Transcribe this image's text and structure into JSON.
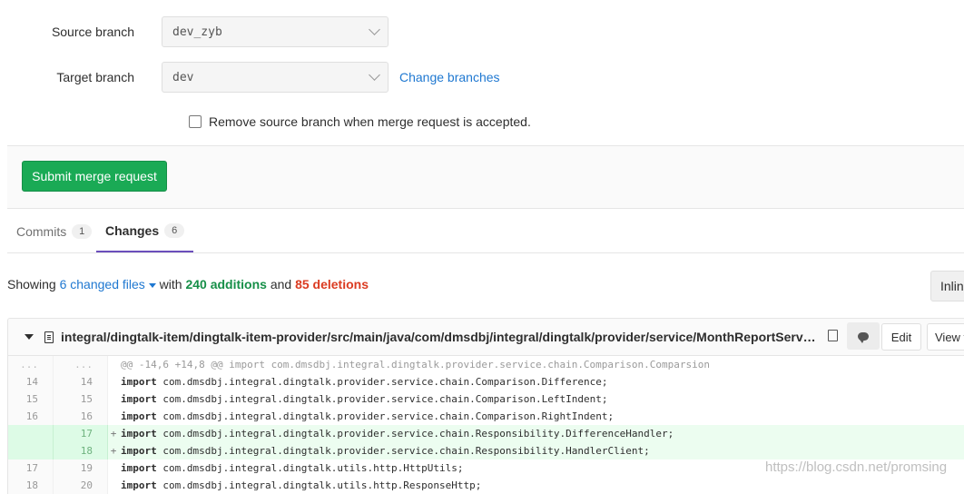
{
  "form": {
    "source_label": "Source branch",
    "source_value": "dev_zyb",
    "target_label": "Target branch",
    "target_value": "dev",
    "change_branches": "Change branches",
    "remove_branch_label": "Remove source branch when merge request is accepted.",
    "remove_branch_checked": false
  },
  "submit_label": "Submit merge request",
  "tabs": [
    {
      "label": "Commits",
      "count": "1",
      "active": false
    },
    {
      "label": "Changes",
      "count": "6",
      "active": true
    }
  ],
  "summary": {
    "showing": "Showing",
    "changed_files": "6 changed files",
    "with": "with",
    "additions": "240 additions",
    "and": "and",
    "deletions": "85 deletions"
  },
  "view_toggle": {
    "inline": "Inlin"
  },
  "file": {
    "path": "integral/dingtalk-item/dingtalk-item-provider/src/main/java/com/dmsdbj/integral/dingtalk/provider/service/MonthReportServiceImpl.java",
    "edit_label": "Edit",
    "view_label": "View f"
  },
  "diff_lines": [
    {
      "type": "match",
      "old": "...",
      "new": "...",
      "sign": "",
      "keyword": "",
      "text": "@@ -14,6 +14,8 @@ import com.dmsdbj.integral.dingtalk.provider.service.chain.Comparison.Comparsion"
    },
    {
      "type": "context",
      "old": "14",
      "new": "14",
      "sign": "",
      "keyword": "import",
      "text": " com.dmsdbj.integral.dingtalk.provider.service.chain.Comparison.Difference;"
    },
    {
      "type": "context",
      "old": "15",
      "new": "15",
      "sign": "",
      "keyword": "import",
      "text": " com.dmsdbj.integral.dingtalk.provider.service.chain.Comparison.LeftIndent;"
    },
    {
      "type": "context",
      "old": "16",
      "new": "16",
      "sign": "",
      "keyword": "import",
      "text": " com.dmsdbj.integral.dingtalk.provider.service.chain.Comparison.RightIndent;"
    },
    {
      "type": "added",
      "old": "",
      "new": "17",
      "sign": "+",
      "keyword": "import",
      "text": " com.dmsdbj.integral.dingtalk.provider.service.chain.Responsibility.DifferenceHandler;"
    },
    {
      "type": "added",
      "old": "",
      "new": "18",
      "sign": "+",
      "keyword": "import",
      "text": " com.dmsdbj.integral.dingtalk.provider.service.chain.Responsibility.HandlerClient;"
    },
    {
      "type": "context",
      "old": "17",
      "new": "19",
      "sign": "",
      "keyword": "import",
      "text": " com.dmsdbj.integral.dingtalk.utils.http.HttpUtils;"
    },
    {
      "type": "context",
      "old": "18",
      "new": "20",
      "sign": "",
      "keyword": "import",
      "text": " com.dmsdbj.integral.dingtalk.utils.http.ResponseHttp;"
    }
  ],
  "watermark": "https://blog.csdn.net/promsing",
  "colors": {
    "submit": "#1aaa55",
    "link": "#1f78d1",
    "additions": "#168f48",
    "deletions": "#db3b21",
    "active_tab": "#6b4fbb",
    "added_line": "#ecfdf0"
  }
}
